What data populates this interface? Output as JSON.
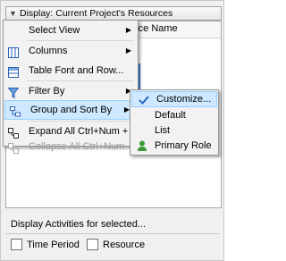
{
  "panel": {
    "header_title": "Display: Current Project's Resources",
    "column_header_name": "rce Name",
    "display_activities_label": "Display Activities for selected...",
    "checkbox_time_period": "Time Period",
    "checkbox_resource": "Resource"
  },
  "context_menu": {
    "items": [
      {
        "label": "Select View",
        "icon": "none",
        "has_submenu": true
      },
      {
        "label": "Columns",
        "icon": "columns-icon",
        "has_submenu": true
      },
      {
        "label": "Table Font and Row...",
        "icon": "table-font-icon",
        "has_submenu": false
      },
      {
        "label": "Filter By",
        "icon": "filter-icon",
        "has_submenu": true
      },
      {
        "label": "Group and Sort By",
        "icon": "group-sort-icon",
        "has_submenu": true,
        "highlighted": true
      },
      {
        "label": "Expand All  Ctrl+Num +",
        "icon": "expand-all-icon",
        "has_submenu": false
      },
      {
        "label": "Collapse All  Ctrl+Num -",
        "icon": "collapse-all-icon",
        "has_submenu": false,
        "disabled": true
      }
    ]
  },
  "submenu": {
    "items": [
      {
        "label": "Customize...",
        "checked": true,
        "highlighted": true
      },
      {
        "label": "Default"
      },
      {
        "label": "List"
      },
      {
        "label": "Primary Role",
        "icon": "person-icon"
      }
    ]
  },
  "colors": {
    "highlight_bg": "#cde8ff",
    "highlight_border": "#99d1ff",
    "menu_bg": "#f2f2f2",
    "check_color": "#1f5fbf"
  }
}
